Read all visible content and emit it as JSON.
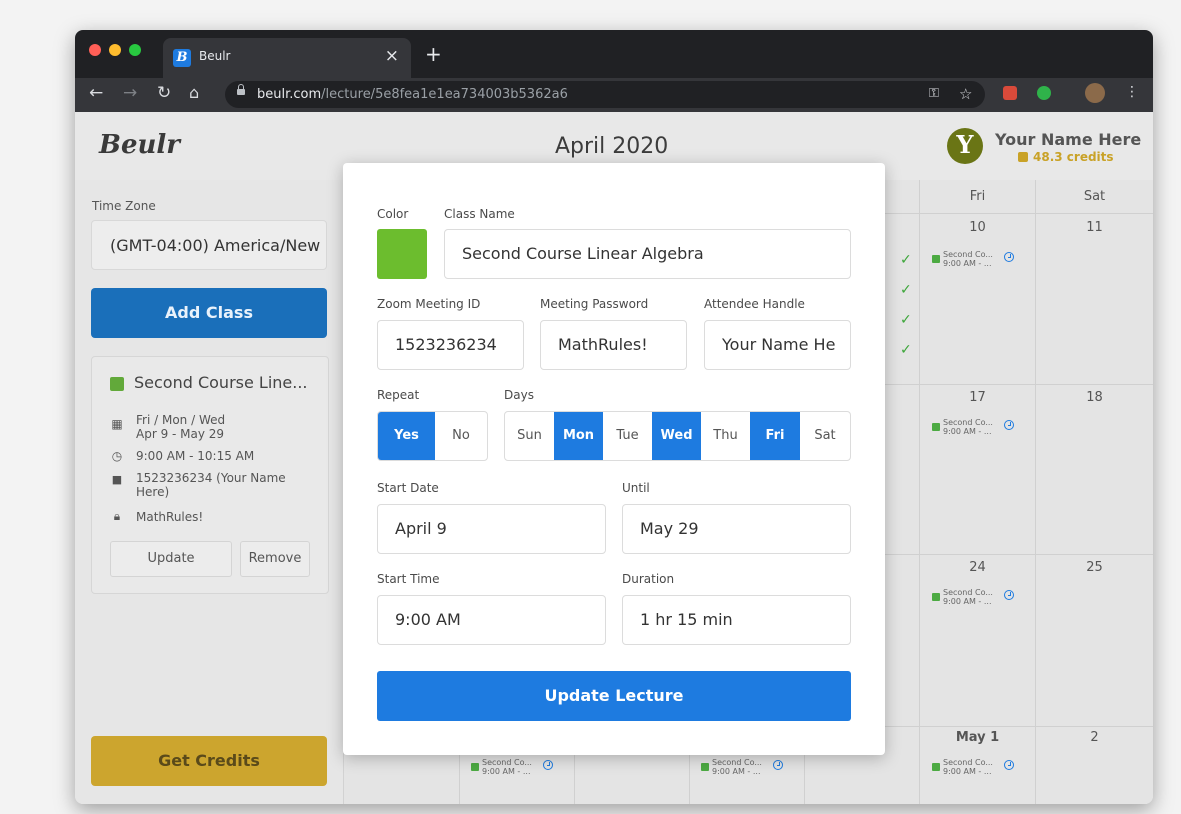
{
  "browser": {
    "tab_title": "Beulr",
    "tab_favicon": "B",
    "new_tab": "+",
    "close": "×",
    "url_host": "beulr.com",
    "url_path": "/lecture/5e8fea1e1ea734003b5362a6"
  },
  "header": {
    "logo": "Beulr",
    "month": "April 2020",
    "user_initial": "Y",
    "user_name": "Your Name Here",
    "credits": "48.3 credits"
  },
  "sidebar": {
    "timezone_label": "Time Zone",
    "timezone_value": "(GMT-04:00) America/New",
    "add_class": "Add Class",
    "class_card": {
      "title": "Second Course Line...",
      "schedule_days": "Fri / Mon / Wed",
      "schedule_dates": "Apr 9 - May 29",
      "time": "9:00 AM - 10:15 AM",
      "meeting_line1": "1523236234 (Your Name",
      "meeting_line2": "Here)",
      "password": "MathRules!",
      "update": "Update",
      "remove": "Remove"
    },
    "get_credits": "Get Credits"
  },
  "calendar": {
    "day_headers": [
      "Fri",
      "Sat"
    ],
    "days": [
      "10",
      "11",
      "17",
      "18",
      "24",
      "25",
      "May 1",
      "2"
    ],
    "event_title": "Second Co...",
    "event_time": "9:00 AM - ..."
  },
  "modal": {
    "color_label": "Color",
    "class_name_label": "Class Name",
    "class_name_value": "Second Course Linear Algebra",
    "zoom_label": "Zoom Meeting ID",
    "zoom_value": "1523236234",
    "password_label": "Meeting Password",
    "password_value": "MathRules!",
    "handle_label": "Attendee Handle",
    "handle_value": "Your Name He",
    "repeat_label": "Repeat",
    "repeat_yes": "Yes",
    "repeat_no": "No",
    "days_label": "Days",
    "days": [
      "Sun",
      "Mon",
      "Tue",
      "Wed",
      "Thu",
      "Fri",
      "Sat"
    ],
    "start_date_label": "Start Date",
    "start_date_value": "April 9",
    "until_label": "Until",
    "until_value": "May 29",
    "start_time_label": "Start Time",
    "start_time_value": "9:00 AM",
    "duration_label": "Duration",
    "duration_value": "1 hr 15 min",
    "update_button": "Update Lecture"
  },
  "colors": {
    "primary": "#1e7be0",
    "class_color": "#6cbd2e",
    "credits_button": "#cca52e",
    "event_check": "#3da63a"
  }
}
